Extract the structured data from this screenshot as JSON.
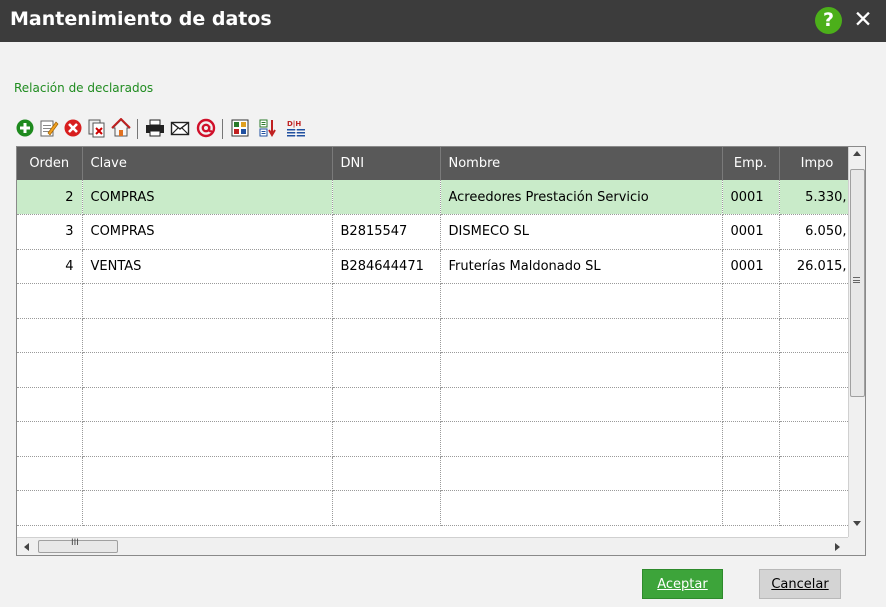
{
  "window": {
    "title": "Mantenimiento de datos",
    "help_label": "?",
    "close_label": "✕"
  },
  "section": {
    "label": "Relación de declarados"
  },
  "toolbar": {
    "icons": [
      "add-icon",
      "edit-icon",
      "delete-icon",
      "copy-icon",
      "home-icon",
      "print-icon",
      "mail-icon",
      "at-icon",
      "export-icon",
      "sort-icon",
      "columns-icon"
    ]
  },
  "table": {
    "columns": [
      "Orden",
      "Clave",
      "DNI",
      "Nombre",
      "Emp.",
      "Impo"
    ],
    "rows": [
      {
        "orden": "2",
        "clave": "COMPRAS",
        "dni": "",
        "nombre": "Acreedores Prestación Servicio",
        "emp": "0001",
        "importe": "5.330,"
      },
      {
        "orden": "3",
        "clave": "COMPRAS",
        "dni": "B2815547",
        "nombre": "DISMECO SL",
        "emp": "0001",
        "importe": "6.050,"
      },
      {
        "orden": "4",
        "clave": "VENTAS",
        "dni": "B284644471",
        "nombre": "Fruterías Maldonado SL",
        "emp": "0001",
        "importe": "26.015,"
      }
    ],
    "selected_row": 0,
    "hscroll_grip": "III"
  },
  "buttons": {
    "accept": "Aceptar",
    "cancel": "Cancelar"
  },
  "colors": {
    "titlebar": "#3c3c3c",
    "accent_green": "#3da43a",
    "section_label": "#208c20",
    "header_bg": "#595959",
    "selected_row": "#c9ebc9"
  }
}
